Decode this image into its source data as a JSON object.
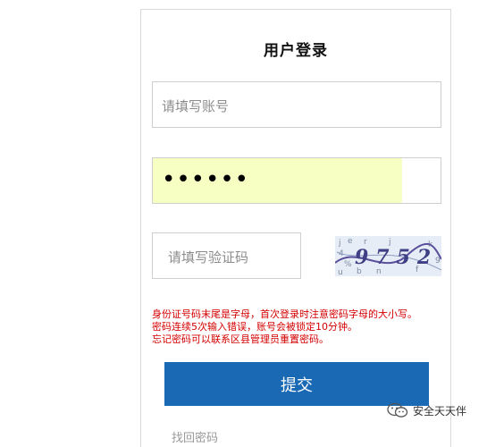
{
  "login": {
    "title": "用户登录",
    "account_placeholder": "请填写账号",
    "password_value": "••••••",
    "captcha_placeholder": "请填写验证码",
    "captcha_text": "9752",
    "notice_lines": [
      "身份证号码末尾是字母，首次登录时注意密码字母的大小写。",
      "密码连续5次输入错误，账号会被锁定10分钟。",
      "忘记密码可以联系区县管理员重置密码。"
    ],
    "submit_label": "提交",
    "forgot_label": "找回密码"
  },
  "watermark": {
    "text": "安全天天伴",
    "icon": "wechat-icon"
  },
  "colors": {
    "primary": "#1a69b4",
    "notice": "#d40000",
    "autofill": "#f8ffc3"
  }
}
